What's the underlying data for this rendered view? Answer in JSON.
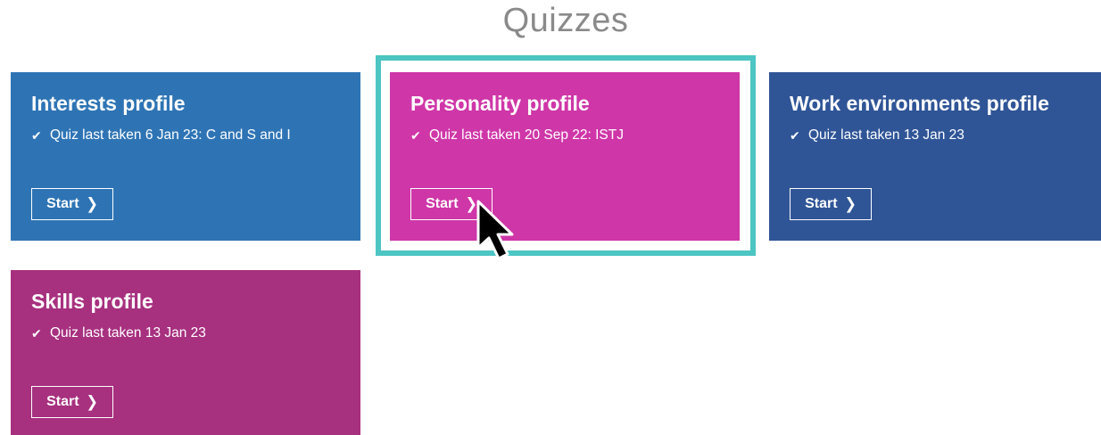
{
  "page": {
    "title": "Quizzes"
  },
  "cards": {
    "interests": {
      "title": "Interests profile",
      "status": "Quiz last taken 6 Jan 23: C and S and I",
      "button_label": "Start",
      "color": "#2e74b5"
    },
    "personality": {
      "title": "Personality profile",
      "status": "Quiz last taken 20 Sep 22: ISTJ",
      "button_label": "Start",
      "color": "#cf36a8",
      "highlighted": true
    },
    "work": {
      "title": "Work environments profile",
      "status": "Quiz last taken 13 Jan 23",
      "button_label": "Start",
      "color": "#2f5597"
    },
    "skills": {
      "title": "Skills profile",
      "status": "Quiz last taken 13 Jan 23",
      "button_label": "Start",
      "color": "#a7307f"
    }
  },
  "icons": {
    "status": "checkmark-icon",
    "button": "chevron-right-icon",
    "pointer": "mouse-cursor-icon"
  },
  "highlight_color": "#4cc5c3"
}
